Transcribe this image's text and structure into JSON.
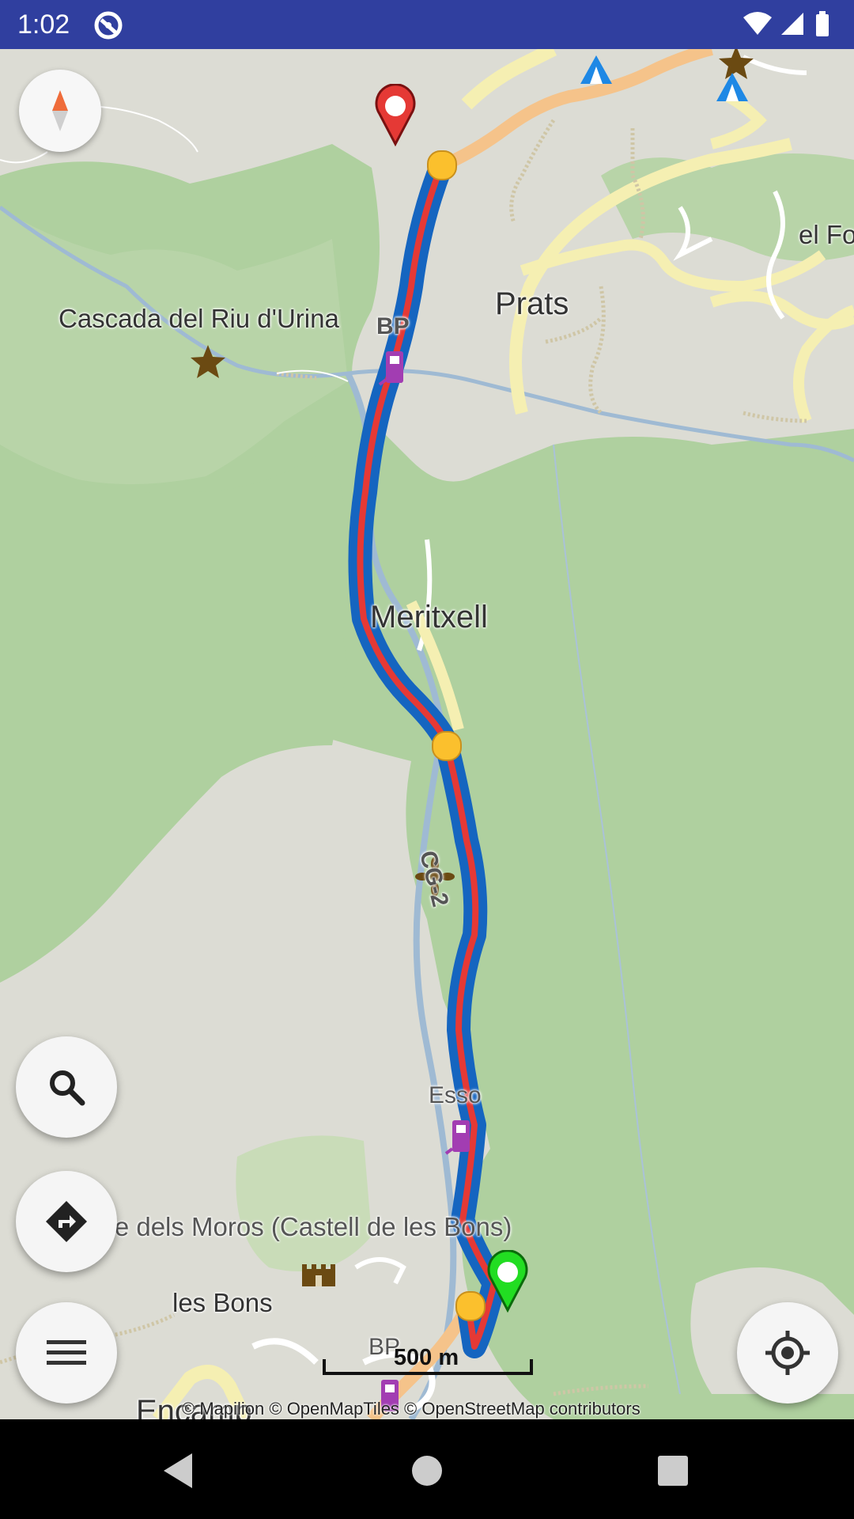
{
  "status_bar": {
    "time": "1:02"
  },
  "map": {
    "labels": {
      "cascada": "Cascada del Riu d'Urina",
      "prats": "Prats",
      "el_fo": "el Fo",
      "meritxell": "Meritxell",
      "bp_top": "BP",
      "cg2": "CG-2",
      "esso": "Esso",
      "torre": "Torre dels Moros (Castell de les Bons)",
      "les_bons": "les Bons",
      "bp_bottom": "BP",
      "encamp": "Encamp"
    },
    "scale": "500 m",
    "attribution": "© Mapilion © OpenMapTiles © OpenStreetMap contributors"
  },
  "colors": {
    "route_outer": "#1565c0",
    "route_inner": "#e53935",
    "destination_pin": "#e53935",
    "start_pin": "#22dd22",
    "waypoint": "#fbc02d",
    "status_bar": "#303f9f"
  },
  "buttons": {
    "compass": "compass-icon",
    "search": "search-icon",
    "directions": "directions-icon",
    "menu": "menu-icon",
    "my_location": "my-location-icon"
  }
}
